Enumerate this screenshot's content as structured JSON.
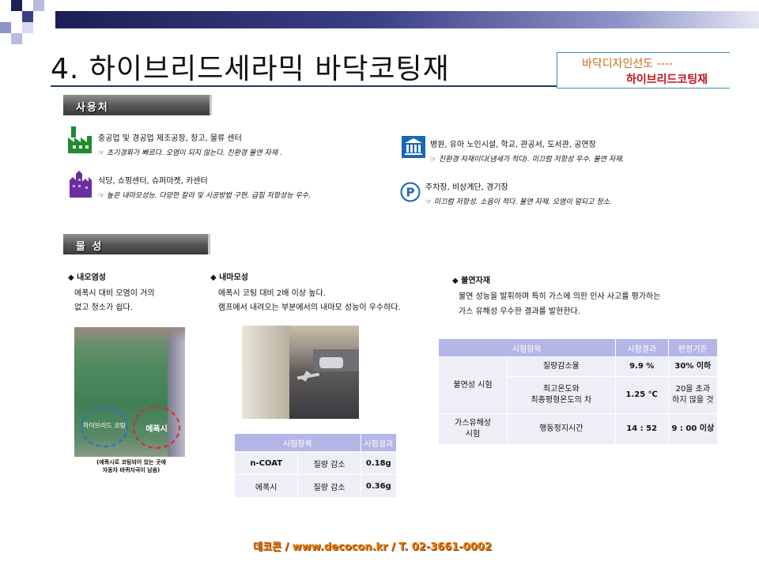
{
  "header": {
    "title": "4. 하이브리드세라믹 바닥코팅재",
    "tag_line1": "바닥디자인선도 ----",
    "tag_line2": "하이브리드코팅재"
  },
  "usage": {
    "section_label": "사용처",
    "items": [
      {
        "icon": "factory-icon",
        "text": "중공업 및 경공업 제조공장, 창고, 물류 센터",
        "note": "☞ 초기경화가 빠르다. 오염이 되지 않는다. 친환경 불연 자재 ."
      },
      {
        "icon": "buildings-icon",
        "text": "식당, 쇼핑센터, 슈퍼마켓, 카센터",
        "note": "☞ 높은 내마모성능. 다양한 칼라 및 시공방법 구현. 급힘 저항성능 우수."
      },
      {
        "icon": "public-building-icon",
        "text": "병원, 유아 노인시설, 학교, 관공서, 도서관, 공연장",
        "note": "☞ 친환경 자재이다(냄새가 적다). 미끄럼 저항성 우수. 불연 자재."
      },
      {
        "icon": "parking-icon",
        "text": "주차장, 비상계단, 경기장",
        "note": "☞ 미끄럼 저항성. 소음이 적다. 불연 자재. 오염이 덜되고 청소."
      }
    ]
  },
  "properties": {
    "section_label": "물 성",
    "stain": {
      "title": "◆ 내오염성",
      "lines": [
        "에폭시 대비 오염이 거의",
        "없고 청소가 쉽다."
      ],
      "circle_left": "하이브리드 코팅",
      "circle_right": "에폭시",
      "caption": [
        "(에폭시로 코팅되어 있는 곳에",
        "자동차 바퀴자국이 남음)"
      ]
    },
    "abrasion": {
      "title": "◆ 내마모성",
      "lines": [
        "에폭시 코팅 대비 2배 이상 높다.",
        "램프에서 내려오는 부분에서의 내마모 성능이 우수하다."
      ]
    },
    "fire": {
      "title": "◆ 불연자재",
      "lines": [
        "불연 성능을 발휘하며 특히 가스에 의한 인사 사고를 평가하는",
        "가스 유해성 우수한 결과를 발현한다."
      ]
    }
  },
  "wear_table": {
    "headers": [
      "시험항목",
      "시험결과"
    ],
    "rows": [
      [
        "n-COAT",
        "질량 감소",
        "0.18g"
      ],
      [
        "에폭시",
        "질량 감소",
        "0.36g"
      ]
    ]
  },
  "fire_table": {
    "headers": [
      "시험항목",
      "시험결과",
      "판정기준"
    ],
    "group1": "불연성 시험",
    "r1": [
      "질량감소율",
      "9.9 %",
      "30% 이하"
    ],
    "r2": [
      "최고온도와\n최종평형온도의 차",
      "1.25 ℃",
      "20을 초과\n하지 않을 것"
    ],
    "group2": "가스유해성\n시험",
    "r3": [
      "행동정지시간",
      "14 : 52",
      "9 : 00 이상"
    ]
  },
  "footer": {
    "text": "데코콘 / www.decocon.kr / T. 02-3661-0002"
  },
  "colors": {
    "accent": "#1f3a6e",
    "icon_green": "#1f8a2e",
    "icon_purple": "#6a2ea0",
    "icon_blue": "#1a67b3",
    "table_header": "#b3b6e6",
    "footer": "#e8780c"
  }
}
